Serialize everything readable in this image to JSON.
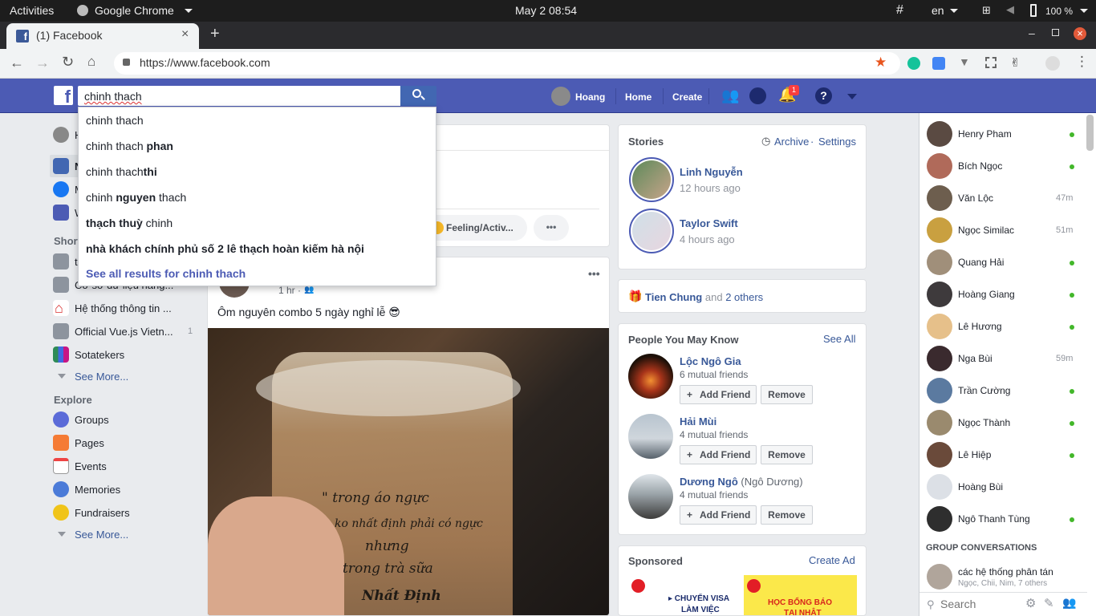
{
  "os": {
    "activities": "Activities",
    "app": "Google Chrome",
    "clock": "May 2  08:54",
    "lang": "en",
    "battery": "100 %"
  },
  "browser": {
    "tab_title": "(1) Facebook",
    "url": "https://www.facebook.com"
  },
  "header": {
    "search_value": "chinh thach",
    "profile_name": "Hoang",
    "home": "Home",
    "create": "Create",
    "notif_count": "1"
  },
  "search_suggestions": [
    {
      "plain": "chinh thach",
      "bold": ""
    },
    {
      "plain": "chinh thach ",
      "bold": "phan"
    },
    {
      "plain": "chinh thach",
      "bold": "thi"
    },
    {
      "pre": "chinh ",
      "bold": "nguyen",
      "post": " thach"
    },
    {
      "bold": "thạch thuỳ",
      "post": " chinh"
    },
    {
      "bold": "nhà khách chính phủ số 2 lê thạch hoàn kiếm hà nội"
    }
  ],
  "search_see_all": "See all results for chinh thach",
  "left_nav": {
    "profile_initial": "H",
    "items": [
      "N",
      "M",
      "W"
    ],
    "shortcuts_title": "Short",
    "shortcuts": [
      {
        "label": "tl",
        "count": ""
      },
      {
        "label": "Cơ sở dữ liệu nâng...",
        "count": ""
      },
      {
        "label": "Hệ thống thông tin ...",
        "count": ""
      },
      {
        "label": "Official Vue.js Vietn...",
        "count": "1"
      },
      {
        "label": "Sotatekers",
        "count": ""
      }
    ],
    "see_more": "See More...",
    "explore_title": "Explore",
    "explore": [
      "Groups",
      "Pages",
      "Events",
      "Memories",
      "Fundraisers"
    ],
    "see_more2": "See More..."
  },
  "composer": {
    "feeling": "Feeling/Activ...",
    "more": "•••"
  },
  "post": {
    "time": "1 hr ·",
    "text": "Ôm nguyên combo 5 ngày nghỉ lễ 😎",
    "menu": "•••",
    "cup_text": [
      "\" trong áo ngực",
      "ko nhất định phải có ngực",
      "nhưng",
      "trong trà sữa",
      "Nhất Định"
    ]
  },
  "stories": {
    "title": "Stories",
    "archive": "Archive",
    "sep": " · ",
    "settings": "Settings",
    "items": [
      {
        "name": "Linh Nguyễn",
        "time": "12 hours ago"
      },
      {
        "name": "Taylor Swift",
        "time": "4 hours ago"
      }
    ]
  },
  "birthday": {
    "name": "Tien Chung",
    "and": " and ",
    "others": "2 others"
  },
  "pymk": {
    "title": "People You May Know",
    "see_all": "See All",
    "add": "Add Friend",
    "remove": "Remove",
    "people": [
      {
        "name": "Lộc Ngô Gia",
        "alt": "",
        "mutual": "6 mutual friends"
      },
      {
        "name": "Hải Mùi",
        "alt": "",
        "mutual": "4 mutual friends"
      },
      {
        "name": "Dương Ngô",
        "alt": " (Ngô Dương)",
        "mutual": "4 mutual friends"
      }
    ]
  },
  "sponsored": {
    "title": "Sponsored",
    "create_ad": "Create Ad",
    "ad1": [
      "▸ CHUYỂN VISA",
      "LÀM VIỆC"
    ],
    "ad2": [
      "HỌC BỔNG BÁO",
      "TẠI NHẬT"
    ]
  },
  "chat": {
    "contacts": [
      {
        "name": "Henry Pham",
        "status": "online",
        "time": ""
      },
      {
        "name": "Bích Ngọc",
        "status": "online",
        "time": ""
      },
      {
        "name": "Văn Lộc",
        "status": "away",
        "time": "47m"
      },
      {
        "name": "Ngọc Similac",
        "status": "away",
        "time": "51m"
      },
      {
        "name": "Quang Hải",
        "status": "online",
        "time": ""
      },
      {
        "name": "Hoàng Giang",
        "status": "online",
        "time": ""
      },
      {
        "name": "Lê Hương",
        "status": "online",
        "time": ""
      },
      {
        "name": "Nga Bùi",
        "status": "away",
        "time": "59m"
      },
      {
        "name": "Trần Cường",
        "status": "online",
        "time": ""
      },
      {
        "name": "Ngọc Thành",
        "status": "online",
        "time": ""
      },
      {
        "name": "Lê Hiệp",
        "status": "online",
        "time": ""
      },
      {
        "name": "Hoàng Bùi",
        "status": "none",
        "time": ""
      },
      {
        "name": "Ngô Thanh Tùng",
        "status": "online",
        "time": ""
      }
    ],
    "group_title": "GROUP CONVERSATIONS",
    "group_name": "các hệ thống phân tán",
    "group_members": "Ngọc, Chii, Nim, 7 others",
    "search_placeholder": "Search"
  },
  "colors": {
    "fb_blue": "#4c5bb4",
    "link": "#385898",
    "online": "#42b72a"
  }
}
